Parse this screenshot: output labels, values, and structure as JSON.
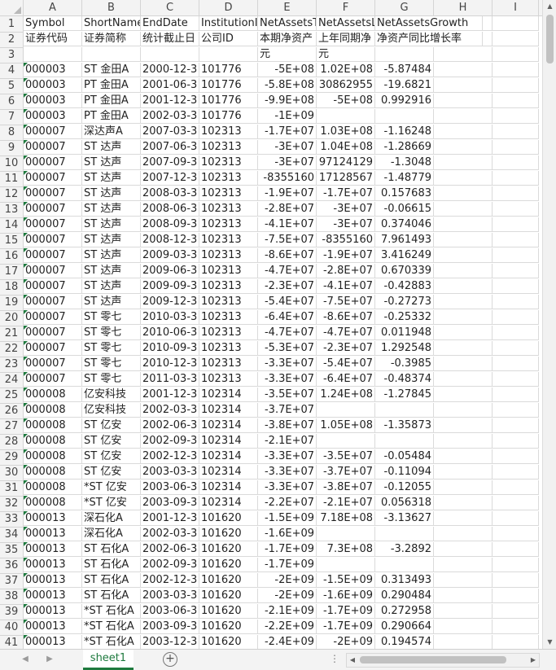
{
  "columns": [
    "A",
    "B",
    "C",
    "D",
    "E",
    "F",
    "G",
    "H",
    "I"
  ],
  "rows": [
    {
      "n": "1",
      "c": [
        "Symbol",
        "ShortName",
        "EndDate",
        "InstitutionID",
        "NetAssetsT",
        "NetAssetsL",
        "NetAssetsGrowth",
        "",
        ""
      ]
    },
    {
      "n": "2",
      "c": [
        "证券代码",
        "证券简称",
        "统计截止日",
        "公司ID",
        "本期净资产",
        "上年同期净",
        "净资产同比增长率",
        "",
        ""
      ]
    },
    {
      "n": "3",
      "c": [
        "",
        "",
        "",
        "",
        "元",
        "元",
        "",
        "",
        ""
      ]
    },
    {
      "n": "4",
      "c": [
        "000003",
        "ST 金田A",
        "2000-12-3",
        "101776",
        "-5E+08",
        "1.02E+08",
        "-5.87484",
        "",
        ""
      ]
    },
    {
      "n": "5",
      "c": [
        "000003",
        "PT 金田A",
        "2001-06-3",
        "101776",
        "-5.8E+08",
        "30862955",
        "-19.6821",
        "",
        ""
      ]
    },
    {
      "n": "6",
      "c": [
        "000003",
        "PT 金田A",
        "2001-12-3",
        "101776",
        "-9.9E+08",
        "-5E+08",
        "0.992916",
        "",
        ""
      ]
    },
    {
      "n": "7",
      "c": [
        "000003",
        "PT 金田A",
        "2002-03-3",
        "101776",
        "-1E+09",
        "",
        "",
        "",
        ""
      ]
    },
    {
      "n": "8",
      "c": [
        "000007",
        "深达声A",
        "2007-03-3",
        "102313",
        "-1.7E+07",
        "1.03E+08",
        "-1.16248",
        "",
        ""
      ]
    },
    {
      "n": "9",
      "c": [
        "000007",
        "ST 达声",
        "2007-06-3",
        "102313",
        "-3E+07",
        "1.04E+08",
        "-1.28669",
        "",
        ""
      ]
    },
    {
      "n": "10",
      "c": [
        "000007",
        "ST 达声",
        "2007-09-3",
        "102313",
        "-3E+07",
        "97124129",
        "-1.3048",
        "",
        ""
      ]
    },
    {
      "n": "11",
      "c": [
        "000007",
        "ST 达声",
        "2007-12-3",
        "102313",
        "-8355160",
        "17128567",
        "-1.48779",
        "",
        ""
      ]
    },
    {
      "n": "12",
      "c": [
        "000007",
        "ST 达声",
        "2008-03-3",
        "102313",
        "-1.9E+07",
        "-1.7E+07",
        "0.157683",
        "",
        ""
      ]
    },
    {
      "n": "13",
      "c": [
        "000007",
        "ST 达声",
        "2008-06-3",
        "102313",
        "-2.8E+07",
        "-3E+07",
        "-0.06615",
        "",
        ""
      ]
    },
    {
      "n": "14",
      "c": [
        "000007",
        "ST 达声",
        "2008-09-3",
        "102313",
        "-4.1E+07",
        "-3E+07",
        "0.374046",
        "",
        ""
      ]
    },
    {
      "n": "15",
      "c": [
        "000007",
        "ST 达声",
        "2008-12-3",
        "102313",
        "-7.5E+07",
        "-8355160",
        "7.961493",
        "",
        ""
      ]
    },
    {
      "n": "16",
      "c": [
        "000007",
        "ST 达声",
        "2009-03-3",
        "102313",
        "-8.6E+07",
        "-1.9E+07",
        "3.416249",
        "",
        ""
      ]
    },
    {
      "n": "17",
      "c": [
        "000007",
        "ST 达声",
        "2009-06-3",
        "102313",
        "-4.7E+07",
        "-2.8E+07",
        "0.670339",
        "",
        ""
      ]
    },
    {
      "n": "18",
      "c": [
        "000007",
        "ST 达声",
        "2009-09-3",
        "102313",
        "-2.3E+07",
        "-4.1E+07",
        "-0.42883",
        "",
        ""
      ]
    },
    {
      "n": "19",
      "c": [
        "000007",
        "ST 达声",
        "2009-12-3",
        "102313",
        "-5.4E+07",
        "-7.5E+07",
        "-0.27273",
        "",
        ""
      ]
    },
    {
      "n": "20",
      "c": [
        "000007",
        "ST 零七",
        "2010-03-3",
        "102313",
        "-6.4E+07",
        "-8.6E+07",
        "-0.25332",
        "",
        ""
      ]
    },
    {
      "n": "21",
      "c": [
        "000007",
        "ST 零七",
        "2010-06-3",
        "102313",
        "-4.7E+07",
        "-4.7E+07",
        "0.011948",
        "",
        ""
      ]
    },
    {
      "n": "22",
      "c": [
        "000007",
        "ST 零七",
        "2010-09-3",
        "102313",
        "-5.3E+07",
        "-2.3E+07",
        "1.292548",
        "",
        ""
      ]
    },
    {
      "n": "23",
      "c": [
        "000007",
        "ST 零七",
        "2010-12-3",
        "102313",
        "-3.3E+07",
        "-5.4E+07",
        "-0.3985",
        "",
        ""
      ]
    },
    {
      "n": "24",
      "c": [
        "000007",
        "ST 零七",
        "2011-03-3",
        "102313",
        "-3.3E+07",
        "-6.4E+07",
        "-0.48374",
        "",
        ""
      ]
    },
    {
      "n": "25",
      "c": [
        "000008",
        "亿安科技",
        "2001-12-3",
        "102314",
        "-3.5E+07",
        "1.24E+08",
        "-1.27845",
        "",
        ""
      ]
    },
    {
      "n": "26",
      "c": [
        "000008",
        "亿安科技",
        "2002-03-3",
        "102314",
        "-3.7E+07",
        "",
        "",
        "",
        ""
      ]
    },
    {
      "n": "27",
      "c": [
        "000008",
        "ST 亿安",
        "2002-06-3",
        "102314",
        "-3.8E+07",
        "1.05E+08",
        "-1.35873",
        "",
        ""
      ]
    },
    {
      "n": "28",
      "c": [
        "000008",
        "ST 亿安",
        "2002-09-3",
        "102314",
        "-2.1E+07",
        "",
        "",
        "",
        ""
      ]
    },
    {
      "n": "29",
      "c": [
        "000008",
        "ST 亿安",
        "2002-12-3",
        "102314",
        "-3.3E+07",
        "-3.5E+07",
        "-0.05484",
        "",
        ""
      ]
    },
    {
      "n": "30",
      "c": [
        "000008",
        "ST 亿安",
        "2003-03-3",
        "102314",
        "-3.3E+07",
        "-3.7E+07",
        "-0.11094",
        "",
        ""
      ]
    },
    {
      "n": "31",
      "c": [
        "000008",
        "*ST 亿安",
        "2003-06-3",
        "102314",
        "-3.3E+07",
        "-3.8E+07",
        "-0.12055",
        "",
        ""
      ]
    },
    {
      "n": "32",
      "c": [
        "000008",
        "*ST 亿安",
        "2003-09-3",
        "102314",
        "-2.2E+07",
        "-2.1E+07",
        "0.056318",
        "",
        ""
      ]
    },
    {
      "n": "33",
      "c": [
        "000013",
        "深石化A",
        "2001-12-3",
        "101620",
        "-1.5E+09",
        "7.18E+08",
        "-3.13627",
        "",
        ""
      ]
    },
    {
      "n": "34",
      "c": [
        "000013",
        "深石化A",
        "2002-03-3",
        "101620",
        "-1.6E+09",
        "",
        "",
        "",
        ""
      ]
    },
    {
      "n": "35",
      "c": [
        "000013",
        "ST 石化A",
        "2002-06-3",
        "101620",
        "-1.7E+09",
        "7.3E+08",
        "-3.2892",
        "",
        ""
      ]
    },
    {
      "n": "36",
      "c": [
        "000013",
        "ST 石化A",
        "2002-09-3",
        "101620",
        "-1.7E+09",
        "",
        "",
        "",
        ""
      ]
    },
    {
      "n": "37",
      "c": [
        "000013",
        "ST 石化A",
        "2002-12-3",
        "101620",
        "-2E+09",
        "-1.5E+09",
        "0.313493",
        "",
        ""
      ]
    },
    {
      "n": "38",
      "c": [
        "000013",
        "ST 石化A",
        "2003-03-3",
        "101620",
        "-2E+09",
        "-1.6E+09",
        "0.290484",
        "",
        ""
      ]
    },
    {
      "n": "39",
      "c": [
        "000013",
        "*ST 石化A",
        "2003-06-3",
        "101620",
        "-2.1E+09",
        "-1.7E+09",
        "0.272958",
        "",
        ""
      ]
    },
    {
      "n": "40",
      "c": [
        "000013",
        "*ST 石化A",
        "2003-09-3",
        "101620",
        "-2.2E+09",
        "-1.7E+09",
        "0.290664",
        "",
        ""
      ]
    },
    {
      "n": "41",
      "c": [
        "000013",
        "*ST 石化A",
        "2003-12-3",
        "101620",
        "-2.4E+09",
        "-2E+09",
        "0.194574",
        "",
        ""
      ]
    }
  ],
  "tabs": [
    {
      "label": "sheet1",
      "active": true
    }
  ],
  "add_sheet": "+",
  "dots": "⋮",
  "accent": "#1e7a3e"
}
